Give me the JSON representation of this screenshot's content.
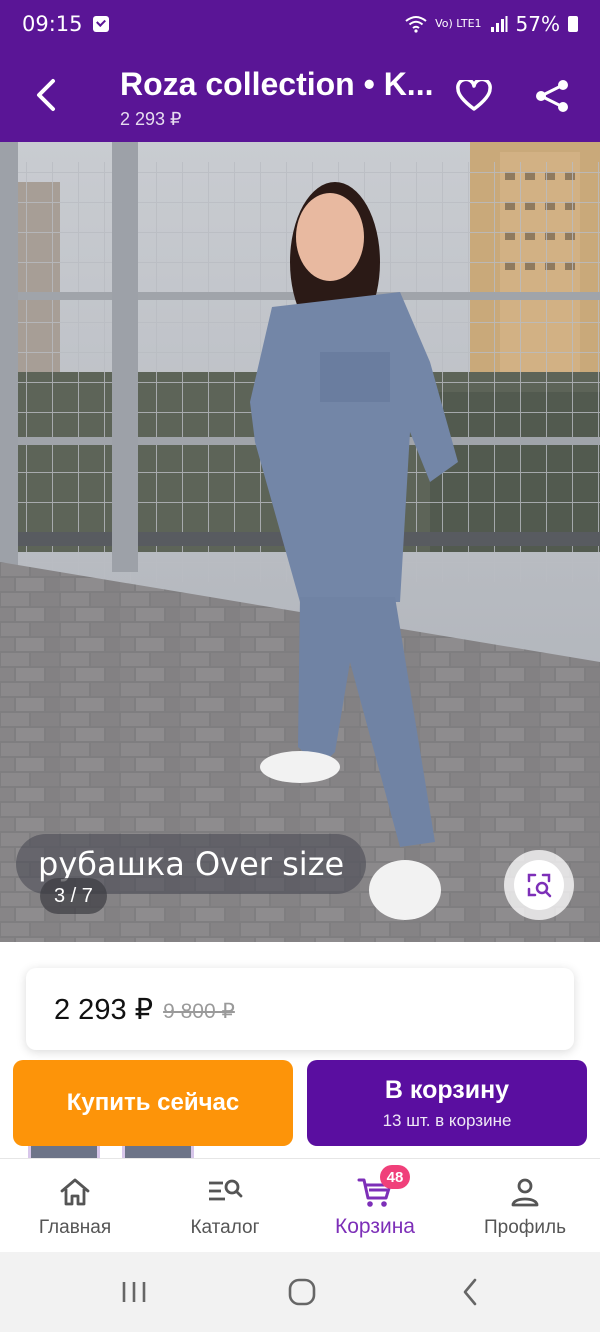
{
  "status_bar": {
    "time": "09:15",
    "network": "Vo) LTE1",
    "battery": "57%"
  },
  "app_bar": {
    "title": "Roza collection • K...",
    "subtitle": "2 293 ₽"
  },
  "photo": {
    "caption": "рубашка Over size",
    "counter": "3 / 7"
  },
  "price": {
    "current": "2 293 ₽",
    "old": "9 800 ₽"
  },
  "actions": {
    "buy_now": "Купить сейчас",
    "add_to_cart": "В корзину",
    "in_cart": "13 шт. в корзине"
  },
  "bottom_nav": {
    "items": [
      {
        "label": "Главная",
        "icon": "home-icon"
      },
      {
        "label": "Каталог",
        "icon": "catalog-search-icon"
      },
      {
        "label": "Корзина",
        "icon": "cart-icon",
        "badge": "48",
        "active": true
      },
      {
        "label": "Профиль",
        "icon": "profile-icon"
      }
    ]
  },
  "colors": {
    "brand": "#5a1596",
    "buy_now": "#fd9409",
    "add_to_cart": "#5a0ea0",
    "active_nav": "#7d2fb8",
    "badge": "#f0407a"
  }
}
